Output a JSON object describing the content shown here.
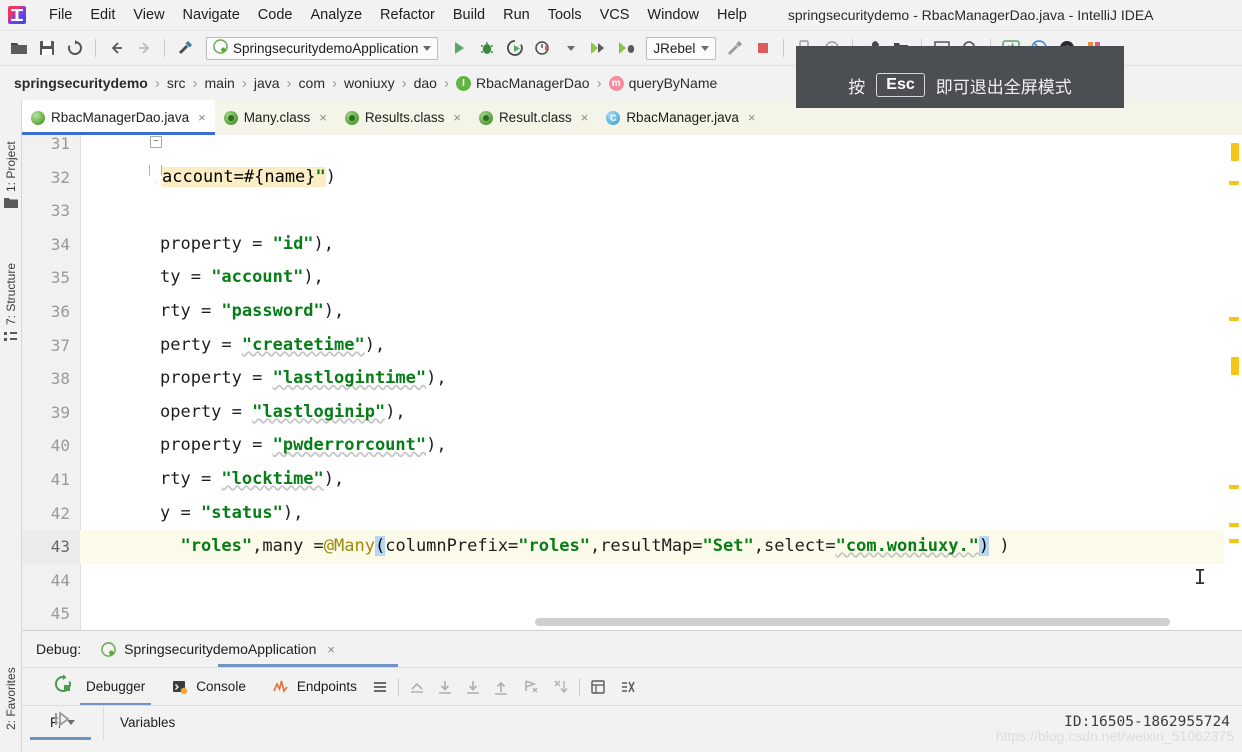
{
  "window": {
    "title": "springsecuritydemo - RbacManagerDao.java - IntelliJ IDEA",
    "logo_icon": "intellij-idea-logo"
  },
  "menubar": {
    "items": [
      {
        "label": "File"
      },
      {
        "label": "Edit"
      },
      {
        "label": "View"
      },
      {
        "label": "Navigate"
      },
      {
        "label": "Code"
      },
      {
        "label": "Analyze"
      },
      {
        "label": "Refactor"
      },
      {
        "label": "Build"
      },
      {
        "label": "Run"
      },
      {
        "label": "Tools"
      },
      {
        "label": "VCS"
      },
      {
        "label": "Window"
      },
      {
        "label": "Help"
      }
    ]
  },
  "toolbar": {
    "icons_left": [
      {
        "name": "open-folder-icon"
      },
      {
        "name": "save-all-icon"
      },
      {
        "name": "sync-refresh-icon"
      },
      {
        "name": "navigate-back-icon"
      },
      {
        "name": "navigate-forward-icon"
      },
      {
        "name": "build-hammer-icon"
      }
    ],
    "run_config": {
      "label": "SpringsecuritydemoApplication",
      "icon": "spring-boot-icon"
    },
    "icons_run": [
      {
        "name": "run-icon"
      },
      {
        "name": "debug-icon"
      },
      {
        "name": "run-with-coverage-icon"
      },
      {
        "name": "profiler-icon"
      },
      {
        "name": "jrebel-run-icon"
      },
      {
        "name": "jrebel-debug-icon"
      }
    ],
    "jrebel": {
      "label": "JRebel"
    },
    "icons_right": [
      {
        "name": "build-project-icon"
      },
      {
        "name": "stop-icon"
      },
      {
        "name": "device-manager-icon"
      },
      {
        "name": "sync-gradle-icon"
      },
      {
        "name": "settings-wrench-icon"
      },
      {
        "name": "project-structure-icon"
      },
      {
        "name": "terminal-icon"
      },
      {
        "name": "search-everywhere-icon"
      },
      {
        "name": "monitor-icon"
      },
      {
        "name": "no-entry-icon"
      },
      {
        "name": "database-disk-icon"
      },
      {
        "name": "plugins-grid-icon"
      }
    ]
  },
  "breadcrumb": {
    "items": [
      {
        "label": "springsecuritydemo",
        "bold": true,
        "icon": ""
      },
      {
        "label": "src",
        "icon": ""
      },
      {
        "label": "main",
        "icon": ""
      },
      {
        "label": "java",
        "icon": ""
      },
      {
        "label": "com",
        "icon": ""
      },
      {
        "label": "woniuxy",
        "icon": ""
      },
      {
        "label": "dao",
        "icon": ""
      },
      {
        "label": "RbacManagerDao",
        "icon": "interface-badge"
      },
      {
        "label": "queryByName",
        "icon": "method-badge"
      }
    ],
    "separator": "›"
  },
  "fullscreen_overlay": {
    "prefix": "按",
    "key": "Esc",
    "suffix": "即可退出全屏模式"
  },
  "left_toolwindows": [
    {
      "label": "1: Project",
      "icon": "project-folder-icon"
    },
    {
      "label": "7: Structure",
      "icon": "structure-icon"
    },
    {
      "label": "2: Favorites",
      "icon": "favorites-icon"
    }
  ],
  "editor_tabs": [
    {
      "label": "RbacManagerDao.java",
      "icon": "interface-icon",
      "active": true,
      "close": "×"
    },
    {
      "label": "Many.class",
      "icon": "class-file-icon",
      "active": false,
      "close": "×"
    },
    {
      "label": "Results.class",
      "icon": "class-file-icon",
      "active": false,
      "close": "×"
    },
    {
      "label": "Result.class",
      "icon": "class-file-icon",
      "active": false,
      "close": "×"
    },
    {
      "label": "RbacManager.java",
      "icon": "class-icon",
      "active": false,
      "close": "×"
    }
  ],
  "editor": {
    "first_visible_line": 31,
    "current_line": 43,
    "lines": [
      {
        "no": "31",
        "text": "",
        "highlight": false
      },
      {
        "no": "32",
        "text": "account=#{name}\")",
        "highlight": false,
        "style": "line32"
      },
      {
        "no": "33",
        "text": "",
        "highlight": false
      },
      {
        "no": "34",
        "text": "property = \"id\"),",
        "highlight": false,
        "style": "prop"
      },
      {
        "no": "35",
        "text": "ty = \"account\"),",
        "highlight": false,
        "style": "prop"
      },
      {
        "no": "36",
        "text": "rty = \"password\"),",
        "highlight": false,
        "style": "prop"
      },
      {
        "no": "37",
        "text": "perty = \"createtime\"),",
        "highlight": false,
        "style": "prop"
      },
      {
        "no": "38",
        "text": "property = \"lastlogintime\"),",
        "highlight": false,
        "style": "prop"
      },
      {
        "no": "39",
        "text": "operty = \"lastloginip\"),",
        "highlight": false,
        "style": "prop"
      },
      {
        "no": "40",
        "text": "property = \"pwderrorcount\"),",
        "highlight": false,
        "style": "prop"
      },
      {
        "no": "41",
        "text": "rty = \"locktime\"),",
        "highlight": false,
        "style": "prop"
      },
      {
        "no": "42",
        "text": "y = \"status\"),",
        "highlight": false,
        "style": "prop"
      },
      {
        "no": "43",
        "text": "\"roles\",many =@Many(columnPrefix=\"roles\",resultMap=\"Set\",select=\"com.woniuxy.\") )",
        "highlight": true,
        "style": "line43"
      },
      {
        "no": "44",
        "text": "",
        "highlight": false
      },
      {
        "no": "45",
        "text": "",
        "highlight": false
      }
    ],
    "line32_segments": [
      {
        "t": "account=#{name}",
        "c": "hl-plain"
      },
      {
        "t": "\"",
        "c": "hl-str"
      },
      {
        "t": ")",
        "c": "plain"
      }
    ],
    "line43_segments": [
      {
        "t": "  ",
        "c": "plain"
      },
      {
        "t": "\"roles\"",
        "c": "str"
      },
      {
        "t": ",many =",
        "c": "plain"
      },
      {
        "t": "@Many",
        "c": "ann"
      },
      {
        "t": "(",
        "c": "paren"
      },
      {
        "t": "columnPrefix=",
        "c": "plain"
      },
      {
        "t": "\"roles\"",
        "c": "str"
      },
      {
        "t": ",resultMap=",
        "c": "plain"
      },
      {
        "t": "\"Set\"",
        "c": "str"
      },
      {
        "t": ",select=",
        "c": "plain"
      },
      {
        "t": "\"com.woniuxy.\"",
        "c": "str-wavy"
      },
      {
        "t": ")",
        "c": "paren"
      },
      {
        "t": " )",
        "c": "plain"
      }
    ]
  },
  "debug_panel": {
    "title_label": "Debug:",
    "session_name": "SpringsecuritydemoApplication",
    "session_close": "×",
    "tabs": [
      {
        "label": "Debugger",
        "icon": "debugger-icon",
        "active": true
      },
      {
        "label": "Console",
        "icon": "console-icon",
        "active": false
      },
      {
        "label": "Endpoints",
        "icon": "endpoints-icon",
        "active": false
      }
    ],
    "toolbar_icons": [
      {
        "name": "menu-lines-icon"
      },
      {
        "name": "step-out-icon"
      },
      {
        "name": "step-over-icon"
      },
      {
        "name": "step-into-icon"
      },
      {
        "name": "force-step-into-icon"
      },
      {
        "name": "run-to-cursor-icon"
      },
      {
        "name": "drop-frame-icon"
      },
      {
        "name": "evaluate-expression-icon"
      },
      {
        "name": "mute-breakpoints-icon"
      }
    ],
    "frames_label": "Fᵣ",
    "variables_label": "Variables",
    "restart_icon": "rerun-icon",
    "resume_icon": "resume-program-icon",
    "id_text": "ID:16505-1862955724"
  },
  "watermark": "https://blog.csdn.net/weixin_51062375",
  "colors": {
    "accent_blue": "#3a6fd0",
    "string_green": "#067d17",
    "annotation_yellow": "#9e880d",
    "current_line_bg": "#fcfae8",
    "tab_bar_bg": "#f5f4e8",
    "marker_yellow": "#f5c518",
    "overlay_bg": "#4b4e52"
  }
}
